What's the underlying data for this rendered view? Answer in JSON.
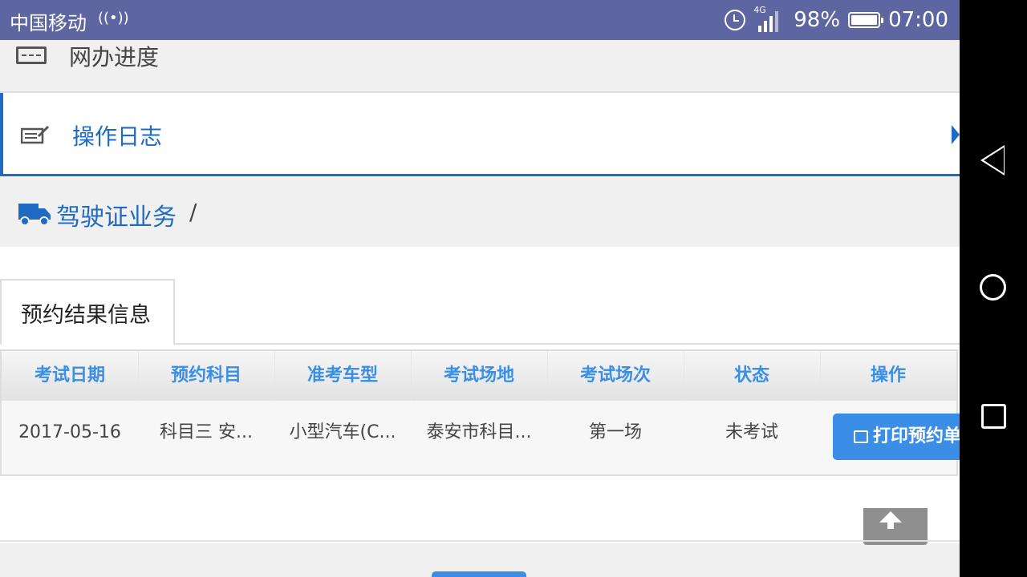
{
  "status_bar": {
    "carrier": "中国移动",
    "signal_wave": "((•))",
    "network_type": "4G",
    "battery": "98%",
    "time": "07:00"
  },
  "menu": {
    "item1": {
      "label": "网办进度",
      "icon": "list-icon"
    },
    "item2": {
      "label": "操作日志",
      "icon": "log-icon",
      "active": true
    }
  },
  "breadcrumb": {
    "icon": "truck-icon",
    "label": "驾驶证业务",
    "separator": "/"
  },
  "tab": {
    "label": "预约结果信息"
  },
  "table": {
    "headers": [
      "考试日期",
      "预约科目",
      "准考车型",
      "考试场地",
      "考试场次",
      "状态",
      "操作"
    ],
    "rows": [
      {
        "date": "2017-05-16",
        "subject": "科目三 安...",
        "vehicle": "小型汽车(C...",
        "venue": "泰安市科目...",
        "session": "第一场",
        "status": "未考试",
        "action": "打印预约单"
      }
    ]
  },
  "colors": {
    "status_bar": "#5d66a0",
    "accent": "#1f6bc4",
    "header_text": "#3a8ee6",
    "button": "#3a8ee6"
  }
}
